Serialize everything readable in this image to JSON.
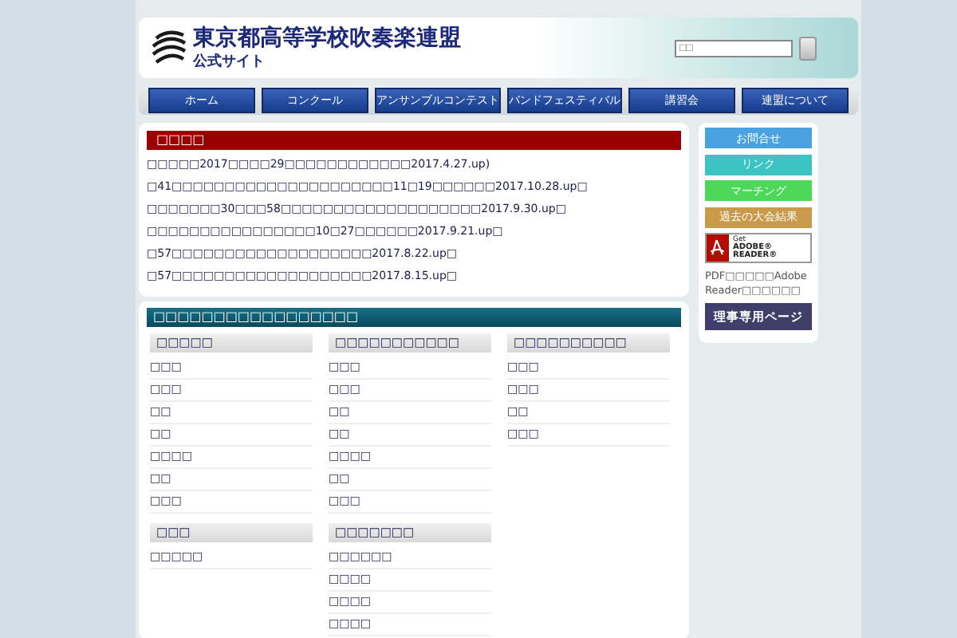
{
  "header": {
    "title": "東京都高等学校吹奏楽連盟",
    "subtitle": "公式サイト",
    "search": {
      "placeholder": "□□"
    }
  },
  "nav": [
    "ホーム",
    "コンクール",
    "アンサンブルコンテスト",
    "バンドフェスティバル",
    "講習会",
    "連盟について"
  ],
  "news": {
    "heading": "□□□□",
    "items": [
      "□□□□□2017□□□□29□□□□□□□□□□□□2017.4.27.up)",
      "□41□□□□□□□□□□□□□□□□□□□□□11□19□□□□□□2017.10.28.up□",
      "□□□□□□□30□□□58□□□□□□□□□□□□□□□□□□□2017.9.30.up□",
      "□□□□□□□□□□□□□□□□10□27□□□□□□2017.9.21.up□",
      "□57□□□□□□□□□□□□□□□□□□□2017.8.22.up□",
      "□57□□□□□□□□□□□□□□□□□□□2017.8.15.up□"
    ]
  },
  "categories": {
    "heading": "□□□□□□□□□□□□□□□□□",
    "columns": [
      [
        {
          "title": "□□□□□",
          "items": [
            "□□□",
            "□□□",
            "□□",
            "□□",
            "□□□□",
            "□□",
            "□□□"
          ]
        },
        {
          "title": "□□□",
          "items": [
            "□□□□□"
          ]
        }
      ],
      [
        {
          "title": "□□□□□□□□□□□",
          "items": [
            "□□□",
            "□□□",
            "□□",
            "□□",
            "□□□□",
            "□□",
            "□□□"
          ]
        },
        {
          "title": "□□□□□□□",
          "items": [
            "□□□□□□",
            "□□□□",
            "□□□□",
            "□□□□"
          ]
        }
      ],
      [
        {
          "title": "□□□□□□□□□□",
          "items": [
            "□□□",
            "□□□",
            "□□",
            "□□□"
          ]
        }
      ]
    ]
  },
  "sidebar": {
    "links": [
      {
        "label": "お問合せ",
        "color": "#4aa3e0"
      },
      {
        "label": "リンク",
        "color": "#3cc4c4"
      },
      {
        "label": "マーチング",
        "color": "#4ed85a"
      },
      {
        "label": "過去の大会結果",
        "color": "#c89a4a"
      }
    ],
    "adobe": {
      "small": "Get",
      "big": "ADOBE® READER®"
    },
    "note": "PDF□□□□□Adobe Reader□□□□□□",
    "members": "理事専用ページ"
  }
}
